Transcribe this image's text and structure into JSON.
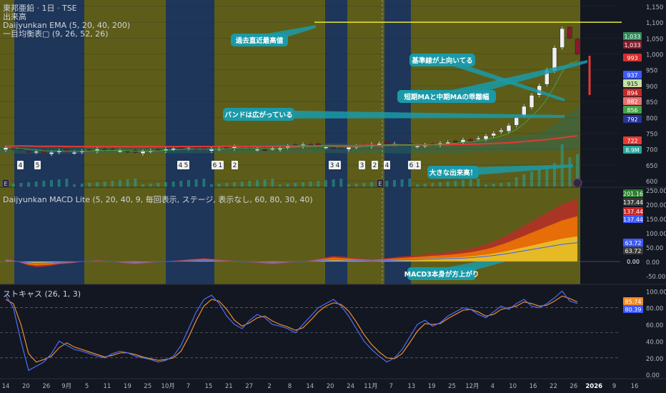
{
  "legend": {
    "title": "東邦亜鉛 · 1日 · TSE",
    "volume": "出来高",
    "ema": "Daijyunkan EMA (5, 20, 40, 200)",
    "ichimoku": "一目均衡表▢ (9, 26, 52, 26)",
    "macd": "Daijyunkan MACD Lite (5, 20, 40, 9, 毎回表示, ステージ, 表示なし, 60, 80, 30, 40)",
    "stoch": "ストキャス (26, 1, 3)"
  },
  "colors": {
    "stage_blue": "#1f3a5f",
    "stage_yellow": "#6b6a18",
    "up_candle": "#f0f0f0",
    "down_candle": "#8b1a2b",
    "annotation": "#1a9aa8",
    "ema_red": "#e53935",
    "high_line": "#e8e83a",
    "stoch_k": "#4c6ef5",
    "stoch_d": "#f08c2c"
  },
  "annotations": [
    {
      "id": "ann-high",
      "text": "過去直近最高値"
    },
    {
      "id": "ann-kijun",
      "text": "基準線が上向いてる"
    },
    {
      "id": "ann-spread",
      "text": "短期MAと中期MAの乖離幅"
    },
    {
      "id": "ann-band",
      "text": "バンドは広がっている"
    },
    {
      "id": "ann-volume",
      "text": "大きな出来高！"
    },
    {
      "id": "ann-macd",
      "text": "MACD3本身が方上がり"
    }
  ],
  "stage_numbers": [
    "4",
    "5",
    "4",
    "5",
    "6",
    "1",
    "2",
    "3",
    "4",
    "3",
    "2",
    "4",
    "6",
    "1"
  ],
  "event_markers": [
    "E",
    "E"
  ],
  "chart_data": [
    {
      "type": "line",
      "name": "price-panel",
      "ylim": [
        580,
        1170
      ],
      "y_ticks": [
        "1,150",
        "1,100",
        "1,050",
        "1,000",
        "950",
        "900",
        "850",
        "800",
        "750",
        "700",
        "650",
        "600"
      ],
      "price_badges": [
        {
          "label": "1,033",
          "color": "#2e8b57"
        },
        {
          "label": "1,033",
          "color": "#8b1a2b"
        },
        {
          "label": "993",
          "color": "#d32f2f"
        },
        {
          "label": "937",
          "color": "#3d5afe"
        },
        {
          "label": "915",
          "color": "#c5e1a5"
        },
        {
          "label": "894",
          "color": "#c62828"
        },
        {
          "label": "882",
          "color": "#e57373"
        },
        {
          "label": "856",
          "color": "#43a047"
        },
        {
          "label": "792",
          "color": "#283593"
        },
        {
          "label": "722",
          "color": "#e53935"
        },
        {
          "label": "8.9M",
          "color": "#26a69a"
        }
      ],
      "x_labels": [
        "14",
        "20",
        "26",
        "9月",
        "5",
        "11",
        "19",
        "25",
        "10月",
        "7",
        "15",
        "21",
        "27",
        "2",
        "8",
        "14",
        "20",
        "24",
        "11月",
        "7",
        "13",
        "19",
        "25",
        "12月",
        "4",
        "10",
        "16",
        "22",
        "26",
        "2026",
        "9",
        "16"
      ],
      "candles_close": [
        705,
        700,
        698,
        690,
        693,
        688,
        690,
        695,
        692,
        690,
        694,
        697,
        700,
        696,
        698,
        695,
        692,
        690,
        693,
        695,
        698,
        700,
        702,
        705,
        703,
        700,
        698,
        700,
        702,
        705,
        708,
        706,
        703,
        700,
        698,
        702,
        705,
        710,
        712,
        715,
        713,
        710,
        707,
        705,
        703,
        706,
        709,
        712,
        715,
        718,
        720,
        717,
        714,
        712,
        710,
        713,
        716,
        719,
        722,
        725,
        730,
        728,
        735,
        742,
        750,
        760,
        775,
        800,
        835,
        870,
        900,
        950,
        1020,
        1080,
        1050,
        1000
      ],
      "ema_200": [
        710,
        710,
        710,
        710,
        709,
        709,
        709,
        709,
        708,
        708,
        708,
        708,
        708,
        708,
        708,
        708,
        708,
        708,
        708,
        708,
        708,
        708,
        708,
        708,
        708,
        708,
        708,
        708,
        709,
        709,
        709,
        709,
        709,
        709,
        709,
        709,
        710,
        710,
        710,
        710,
        710,
        710,
        711,
        711,
        711,
        711,
        711,
        712,
        712,
        712,
        712,
        712,
        713,
        713,
        713,
        713,
        714,
        714,
        714,
        715,
        715,
        716,
        716,
        717,
        718,
        719,
        720,
        722,
        724,
        726,
        728,
        730,
        733,
        736,
        739,
        742
      ],
      "high_line_value": 1100
    },
    {
      "type": "area",
      "name": "macd-panel",
      "ylim": [
        -80,
        260
      ],
      "y_ticks": [
        "250.00",
        "200.00",
        "150.00",
        "100.00",
        "50.00",
        "0.00",
        "-50.00"
      ],
      "badges": [
        {
          "label": "201.16",
          "color": "#2e7d32"
        },
        {
          "label": "137.44",
          "color": "#3a3a3a"
        },
        {
          "label": "137.44",
          "color": "#c62828"
        },
        {
          "label": "137.44",
          "color": "#3d5afe"
        },
        {
          "label": "63.72",
          "color": "#3d5afe"
        },
        {
          "label": "63.72",
          "color": "#3a3a3a"
        },
        {
          "label": "0.00",
          "color": "#131722"
        }
      ],
      "values": [
        10,
        5,
        -5,
        -15,
        -20,
        -18,
        -15,
        -10,
        -8,
        -5,
        0,
        2,
        5,
        3,
        0,
        -5,
        -8,
        -10,
        -8,
        -5,
        -2,
        0,
        3,
        5,
        8,
        10,
        12,
        10,
        8,
        5,
        3,
        0,
        -3,
        -5,
        -8,
        -10,
        -8,
        -5,
        -2,
        0,
        5,
        10,
        15,
        20,
        18,
        15,
        12,
        10,
        8,
        10,
        12,
        15,
        18,
        20,
        22,
        25,
        28,
        30,
        33,
        36,
        40,
        45,
        52,
        60,
        70,
        82,
        95,
        110,
        125,
        140,
        155,
        170,
        185,
        200,
        210,
        220
      ]
    },
    {
      "type": "line",
      "name": "stochastic-panel",
      "ylim": [
        -5,
        108
      ],
      "y_ticks": [
        "100.00",
        "80.00",
        "60.00",
        "40.00",
        "20.00",
        "0.00"
      ],
      "badges": [
        {
          "label": "85.74",
          "color": "#f08c2c"
        },
        {
          "label": "80.39",
          "color": "#3d5afe"
        }
      ],
      "series": [
        {
          "name": "%K",
          "values": [
            95,
            80,
            40,
            5,
            10,
            15,
            25,
            40,
            35,
            30,
            28,
            25,
            22,
            20,
            25,
            28,
            26,
            22,
            20,
            18,
            15,
            17,
            22,
            35,
            55,
            75,
            90,
            95,
            85,
            70,
            60,
            55,
            65,
            72,
            68,
            60,
            58,
            55,
            50,
            60,
            70,
            80,
            85,
            90,
            82,
            70,
            55,
            40,
            30,
            22,
            15,
            20,
            30,
            45,
            60,
            65,
            58,
            62,
            70,
            75,
            80,
            78,
            72,
            68,
            75,
            82,
            78,
            85,
            90,
            82,
            80,
            85,
            92,
            100,
            88,
            85
          ]
        },
        {
          "name": "%D",
          "values": [
            90,
            85,
            60,
            25,
            15,
            18,
            22,
            32,
            38,
            33,
            30,
            27,
            24,
            21,
            23,
            26,
            26,
            24,
            21,
            19,
            17,
            18,
            20,
            28,
            45,
            65,
            82,
            90,
            88,
            78,
            65,
            58,
            62,
            68,
            70,
            64,
            60,
            57,
            53,
            56,
            65,
            75,
            82,
            86,
            84,
            76,
            63,
            48,
            36,
            27,
            20,
            19,
            25,
            38,
            52,
            61,
            60,
            61,
            67,
            72,
            77,
            78,
            75,
            70,
            72,
            78,
            80,
            82,
            87,
            85,
            82,
            83,
            88,
            94,
            91,
            87
          ]
        }
      ]
    }
  ]
}
